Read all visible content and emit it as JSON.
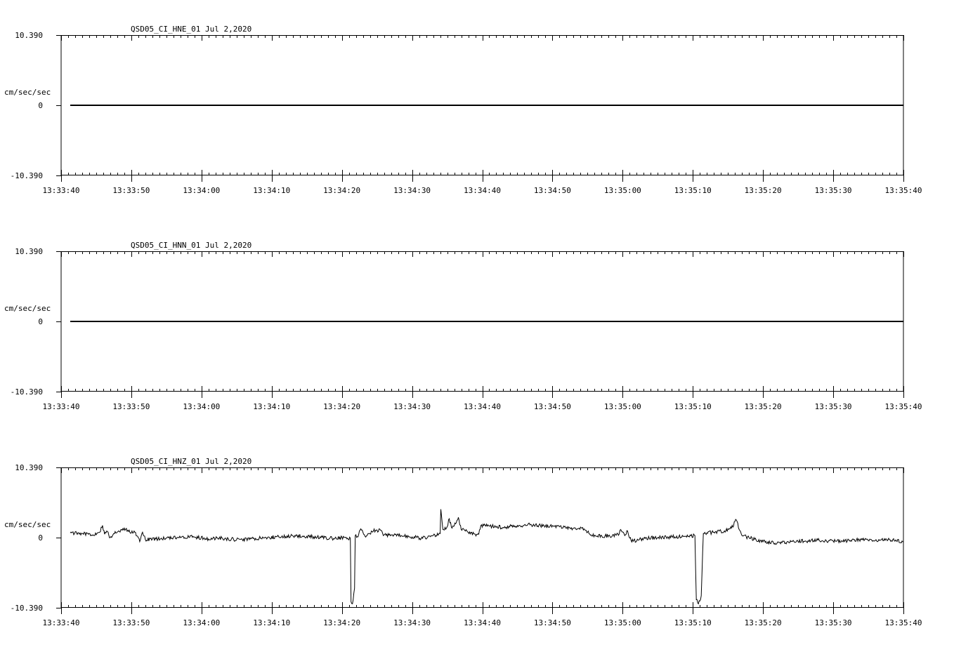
{
  "chart_data": [
    {
      "type": "line",
      "title": "QSD05_CI_HNE_01  Jul 2,2020",
      "ylabel": "cm/sec/sec",
      "ylim": [
        -10.39,
        10.39
      ],
      "yticks": [
        "10.390",
        "0",
        "-10.390"
      ],
      "x_ticks": [
        "13:33:40",
        "13:33:50",
        "13:34:00",
        "13:34:10",
        "13:34:20",
        "13:34:30",
        "13:34:40",
        "13:34:50",
        "13:35:00",
        "13:35:10",
        "13:35:20",
        "13:35:30",
        "13:35:40"
      ],
      "x_range_seconds": [
        0,
        120
      ],
      "grid": false,
      "series": [
        {
          "points": [
            [
              1.3,
              0
            ],
            [
              120,
              0
            ]
          ]
        }
      ]
    },
    {
      "type": "line",
      "title": "QSD05_CI_HNN_01  Jul 2,2020",
      "ylabel": "cm/sec/sec",
      "ylim": [
        -10.39,
        10.39
      ],
      "yticks": [
        "10.390",
        "0",
        "-10.390"
      ],
      "x_ticks": [
        "13:33:40",
        "13:33:50",
        "13:34:00",
        "13:34:10",
        "13:34:20",
        "13:34:30",
        "13:34:40",
        "13:34:50",
        "13:35:00",
        "13:35:10",
        "13:35:20",
        "13:35:30",
        "13:35:40"
      ],
      "x_range_seconds": [
        0,
        120
      ],
      "grid": false,
      "series": [
        {
          "points": [
            [
              1.3,
              0
            ],
            [
              120,
              0
            ]
          ]
        }
      ]
    },
    {
      "type": "line",
      "title": "QSD05_CI_HNZ_01  Jul 2,2020",
      "ylabel": "cm/sec/sec",
      "ylim": [
        -10.39,
        10.39
      ],
      "yticks": [
        "10.390",
        "0",
        "-10.390"
      ],
      "x_ticks": [
        "13:33:40",
        "13:33:50",
        "13:34:00",
        "13:34:10",
        "13:34:20",
        "13:34:30",
        "13:34:40",
        "13:34:50",
        "13:35:00",
        "13:35:10",
        "13:35:20",
        "13:35:30",
        "13:35:40"
      ],
      "x_range_seconds": [
        0,
        120
      ],
      "grid": false,
      "series": [
        {
          "points": [
            [
              1.3,
              0.7
            ],
            [
              3.0,
              0.6
            ],
            [
              4.5,
              0.4
            ],
            [
              5.5,
              0.8
            ],
            [
              5.9,
              1.8
            ],
            [
              6.2,
              0.5
            ],
            [
              6.6,
              0.9
            ],
            [
              7.0,
              0.0
            ],
            [
              7.5,
              0.6
            ],
            [
              8.3,
              0.9
            ],
            [
              9.0,
              1.4
            ],
            [
              9.6,
              0.9
            ],
            [
              10.5,
              0.8
            ],
            [
              10.9,
              0.2
            ],
            [
              11.2,
              -0.6
            ],
            [
              11.6,
              0.8
            ],
            [
              12.0,
              -0.3
            ],
            [
              13.5,
              -0.2
            ],
            [
              15.0,
              -0.1
            ],
            [
              17.0,
              0.0
            ],
            [
              19.0,
              0.1
            ],
            [
              21.0,
              -0.2
            ],
            [
              23.0,
              -0.1
            ],
            [
              25.0,
              -0.3
            ],
            [
              27.0,
              -0.2
            ],
            [
              29.0,
              0.0
            ],
            [
              31.0,
              0.1
            ],
            [
              33.0,
              0.3
            ],
            [
              35.0,
              0.2
            ],
            [
              37.0,
              0.0
            ],
            [
              39.0,
              -0.1
            ],
            [
              40.5,
              0.0
            ],
            [
              41.2,
              -0.1
            ],
            [
              41.3,
              -9.5
            ],
            [
              41.5,
              -9.8
            ],
            [
              41.8,
              -7.5
            ],
            [
              41.9,
              0.3
            ],
            [
              42.3,
              0.1
            ],
            [
              42.7,
              1.3
            ],
            [
              43.0,
              0.8
            ],
            [
              43.3,
              0.2
            ],
            [
              44.5,
              1.0
            ],
            [
              45.5,
              1.1
            ],
            [
              45.9,
              0.3
            ],
            [
              47.0,
              0.4
            ],
            [
              48.5,
              0.3
            ],
            [
              50.0,
              0.1
            ],
            [
              51.5,
              -0.1
            ],
            [
              53.0,
              0.3
            ],
            [
              54.0,
              0.6
            ],
            [
              54.1,
              4.2
            ],
            [
              54.4,
              1.2
            ],
            [
              55.0,
              1.6
            ],
            [
              55.3,
              2.8
            ],
            [
              55.7,
              1.4
            ],
            [
              56.3,
              2.2
            ],
            [
              56.6,
              3.0
            ],
            [
              57.0,
              1.2
            ],
            [
              58.0,
              0.8
            ],
            [
              59.0,
              0.5
            ],
            [
              59.5,
              0.5
            ],
            [
              59.8,
              1.8
            ],
            [
              61.0,
              1.7
            ],
            [
              63.0,
              1.5
            ],
            [
              65.0,
              1.8
            ],
            [
              67.0,
              1.9
            ],
            [
              69.0,
              1.7
            ],
            [
              71.0,
              1.6
            ],
            [
              73.0,
              1.4
            ],
            [
              74.5,
              1.3
            ],
            [
              75.5,
              0.4
            ],
            [
              77.0,
              0.3
            ],
            [
              78.5,
              0.2
            ],
            [
              79.5,
              0.5
            ],
            [
              79.7,
              1.2
            ],
            [
              80.3,
              0.3
            ],
            [
              80.7,
              1.0
            ],
            [
              81.2,
              -0.4
            ],
            [
              82.0,
              -0.5
            ],
            [
              83.0,
              -0.1
            ],
            [
              85.0,
              0.0
            ],
            [
              87.0,
              0.1
            ],
            [
              89.0,
              0.2
            ],
            [
              90.3,
              0.3
            ],
            [
              90.5,
              -9.2
            ],
            [
              90.8,
              -9.8
            ],
            [
              91.2,
              -8.6
            ],
            [
              91.5,
              0.6
            ],
            [
              93.0,
              0.8
            ],
            [
              94.5,
              1.0
            ],
            [
              95.5,
              1.4
            ],
            [
              96.2,
              2.6
            ],
            [
              96.6,
              1.2
            ],
            [
              97.0,
              0.3
            ],
            [
              98.0,
              0.0
            ],
            [
              99.0,
              -0.3
            ],
            [
              100.0,
              -0.6
            ],
            [
              102.0,
              -0.8
            ],
            [
              104.0,
              -0.6
            ],
            [
              106.0,
              -0.5
            ],
            [
              108.0,
              -0.4
            ],
            [
              110.0,
              -0.5
            ],
            [
              112.0,
              -0.5
            ],
            [
              114.0,
              -0.3
            ],
            [
              116.0,
              -0.4
            ],
            [
              118.0,
              -0.3
            ],
            [
              120.0,
              -0.6
            ]
          ]
        }
      ]
    }
  ]
}
